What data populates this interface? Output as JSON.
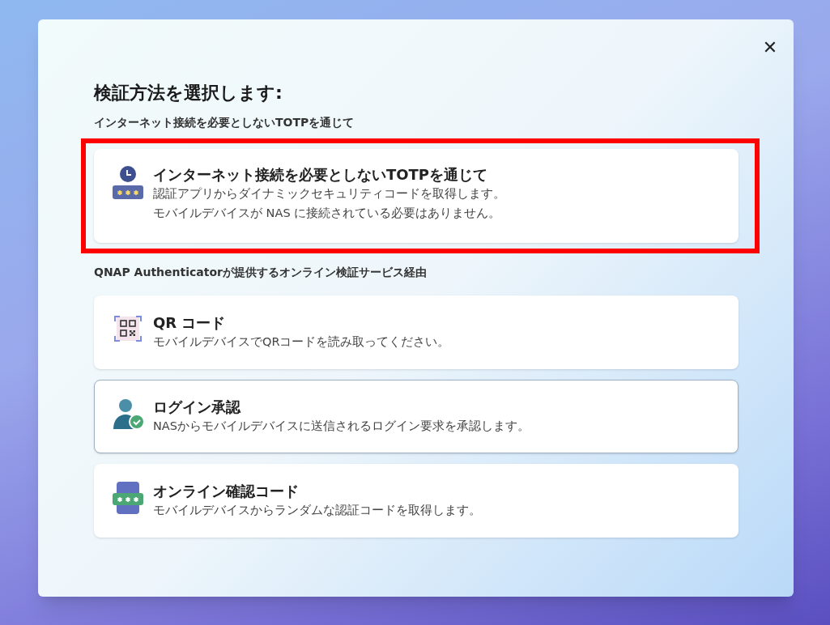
{
  "dialog": {
    "title": "検証方法を選択します:",
    "close": "✕",
    "sections": [
      {
        "label": "インターネット接続を必要としないTOTPを通じて",
        "options": [
          {
            "kind": "totp",
            "title": "インターネット接続を必要としないTOTPを通じて",
            "lines": [
              "認証アプリからダイナミックセキュリティコードを取得します。",
              "モバイルデバイスが NAS に接続されている必要はありません。"
            ],
            "highlighted": true,
            "hovered": false
          }
        ]
      },
      {
        "label": "QNAP Authenticatorが提供するオンライン検証サービス経由",
        "options": [
          {
            "kind": "qr",
            "title": "QR コード",
            "lines": [
              "モバイルデバイスでQRコードを読み取ってください。"
            ],
            "highlighted": false,
            "hovered": false
          },
          {
            "kind": "approval",
            "title": "ログイン承認",
            "lines": [
              "NASからモバイルデバイスに送信されるログイン要求を承認します。"
            ],
            "highlighted": false,
            "hovered": true
          },
          {
            "kind": "code",
            "title": "オンライン確認コード",
            "lines": [
              "モバイルデバイスからランダムな認証コードを取得します。"
            ],
            "highlighted": false,
            "hovered": false
          }
        ]
      }
    ]
  }
}
